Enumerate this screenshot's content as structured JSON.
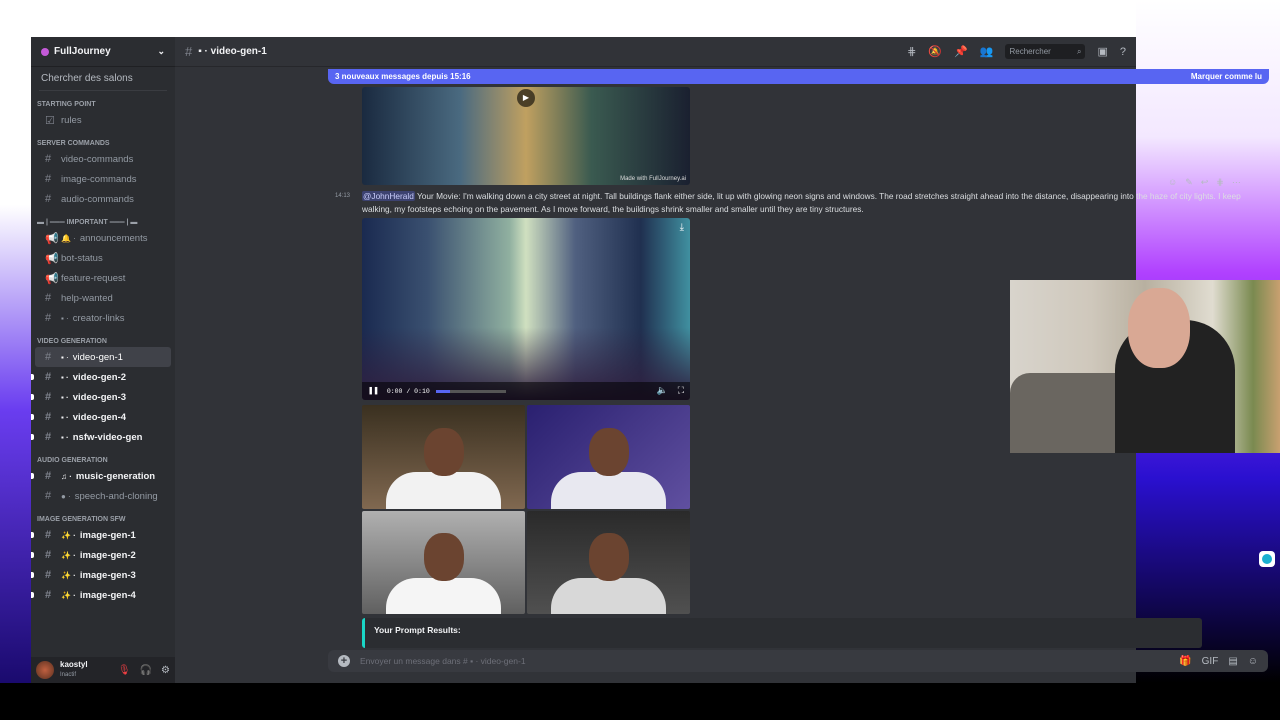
{
  "server": {
    "name": "FullJourney",
    "search": "Chercher des salons"
  },
  "categories": [
    {
      "name": "STARTING POINT",
      "channels": [
        {
          "name": "rules",
          "icon": "rules-icon"
        }
      ]
    },
    {
      "name": "SERVER COMMANDS",
      "channels": [
        {
          "name": "video-commands"
        },
        {
          "name": "image-commands"
        },
        {
          "name": "audio-commands"
        }
      ]
    },
    {
      "name": "▬ | ═══ IMPORTANT ═══ | ▬",
      "channels": [
        {
          "name": "announcements",
          "emoji": "🔔"
        },
        {
          "name": "bot-status"
        },
        {
          "name": "feature-request"
        },
        {
          "name": "help-wanted"
        },
        {
          "name": "creator-links",
          "emoji": "▪"
        }
      ]
    },
    {
      "name": "VIDEO GENERATION",
      "channels": [
        {
          "name": "video-gen-1",
          "emoji": "▪"
        },
        {
          "name": "video-gen-2",
          "emoji": "▪"
        },
        {
          "name": "video-gen-3",
          "emoji": "▪"
        },
        {
          "name": "video-gen-4",
          "emoji": "▪"
        },
        {
          "name": "nsfw-video-gen",
          "emoji": "▪"
        }
      ]
    },
    {
      "name": "AUDIO GENERATION",
      "channels": [
        {
          "name": "music-generation",
          "emoji": "♫"
        },
        {
          "name": "speech-and-cloning",
          "emoji": "●"
        }
      ]
    },
    {
      "name": "IMAGE GENERATION SFW",
      "channels": [
        {
          "name": "image-gen-1",
          "emoji": "✨"
        },
        {
          "name": "image-gen-2",
          "emoji": "✨"
        },
        {
          "name": "image-gen-3",
          "emoji": "✨"
        },
        {
          "name": "image-gen-4",
          "emoji": "✨"
        }
      ]
    }
  ],
  "user": {
    "name": "kaostyl",
    "status": "Inactif"
  },
  "header": {
    "channel": "▪ · video-gen-1",
    "search_placeholder": "Rechercher"
  },
  "banner": {
    "text": "3 nouveaux messages depuis 15:16",
    "action": "Marquer comme lu"
  },
  "message": {
    "time": "14:13",
    "mention": "@JohnHerald",
    "text": " Your Movie: I'm walking down a city street at night. Tall buildings flank either side, lit up with glowing neon signs and windows. The road stretches straight ahead into the distance, disappearing into the haze of city lights. I keep walking, my footsteps echoing on the pavement. As I move forward, the buildings shrink smaller and smaller until they are tiny structures."
  },
  "watermark": "Made with FullJourney.ai",
  "video": {
    "time": "0:00 / 0:10",
    "progress": 0.2
  },
  "embed": {
    "title": "Your Prompt Results:"
  },
  "input": {
    "placeholder": "Envoyer un message dans # ▪ · video-gen-1"
  }
}
